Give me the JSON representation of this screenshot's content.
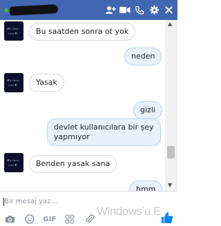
{
  "header": {
    "contact_name": "",
    "status": "online",
    "icons": [
      "add-user-icon",
      "video-call-icon",
      "phone-icon",
      "settings-icon",
      "close-icon"
    ],
    "accent_color": "#4267b2"
  },
  "messages": [
    {
      "direction": "incoming",
      "text": "Bu saatden sonra ot yok",
      "avatar": true
    },
    {
      "direction": "outgoing",
      "text": "neden"
    },
    {
      "direction": "incoming",
      "text": "Yasak",
      "avatar": true
    },
    {
      "direction": "outgoing",
      "text": "gizli"
    },
    {
      "direction": "outgoing",
      "text": "devlet kullanıcılara bir şey\nyapmıyor"
    },
    {
      "direction": "incoming",
      "text": "Benden yasak sana",
      "avatar": true
    },
    {
      "direction": "outgoing",
      "text": "hmm"
    }
  ],
  "composer": {
    "placeholder": "Bir mesaj yaz...",
    "toolbar_icons": [
      "camera-icon",
      "emoji-icon",
      "gif-icon",
      "sticker-icon",
      "attachment-icon",
      "like-icon"
    ],
    "gif_label": "GIF"
  },
  "watermark": "Windows’u E"
}
